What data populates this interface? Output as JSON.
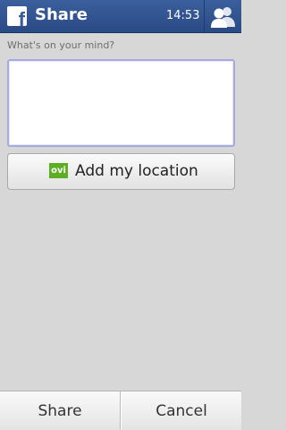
{
  "header": {
    "logo_letter": "f",
    "title": "Share",
    "time": "14:53",
    "friends_icon": "friends-icon"
  },
  "compose": {
    "prompt": "What's on your mind?",
    "value": "",
    "placeholder": ""
  },
  "location": {
    "badge": "ovi",
    "label": "Add my location"
  },
  "softkeys": {
    "left": "Share",
    "right": "Cancel"
  },
  "colors": {
    "header": "#3b5f9d",
    "ovi_green": "#5cae23",
    "input_border": "#a6aae0"
  }
}
